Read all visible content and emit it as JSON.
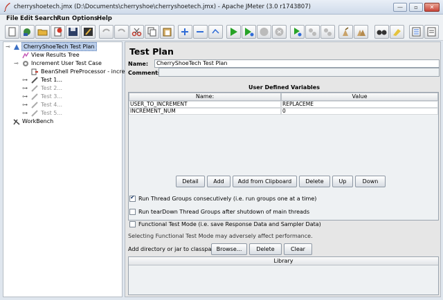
{
  "window": {
    "title": "cherryshoetech.jmx (D:\\Documents\\cherryshoe\\cherryshoetech.jmx) - Apache JMeter (3.0 r1743807)",
    "controls": [
      "—",
      "▫",
      "✕"
    ]
  },
  "menu": [
    "File",
    "Edit",
    "Search",
    "Run",
    "Options",
    "Help"
  ],
  "toolbar": {
    "icons": [
      "new-icon",
      "templates-icon",
      "open-icon",
      "close-icon",
      "save-icon",
      "save-as-icon",
      "cut-icon",
      "copy-icon",
      "paste-icon",
      "expand-icon",
      "collapse-icon",
      "toggle-icon",
      "start-icon",
      "start-no-pause-icon",
      "stop-icon",
      "shutdown-icon",
      "remote-start-icon",
      "remote-stop-icon",
      "remote-shutdown-icon",
      "clear-icon",
      "clear-all-icon",
      "search-icon",
      "reset-search-icon",
      "function-helper-icon",
      "help-icon"
    ]
  },
  "tree": {
    "nodes": [
      {
        "label": "CherryShoeTech Test Plan",
        "icon": "test-plan-icon",
        "selected": true,
        "disabled": false
      },
      {
        "label": "View Results Tree",
        "icon": "listener-icon",
        "selected": false,
        "disabled": false
      },
      {
        "label": "Increment User Test Case",
        "icon": "thread-group-icon",
        "selected": false,
        "disabled": false
      },
      {
        "label": "BeanShell PreProcessor - incre",
        "icon": "preprocessor-icon",
        "selected": false,
        "disabled": false
      },
      {
        "label": "Test 1...",
        "icon": "sampler-icon",
        "selected": false,
        "disabled": false
      },
      {
        "label": "Test 2...",
        "icon": "sampler-icon",
        "selected": false,
        "disabled": true
      },
      {
        "label": "Test 3...",
        "icon": "sampler-icon",
        "selected": false,
        "disabled": true
      },
      {
        "label": "Test 4...",
        "icon": "sampler-icon",
        "selected": false,
        "disabled": true
      },
      {
        "label": "Test 5...",
        "icon": "sampler-icon",
        "selected": false,
        "disabled": true
      },
      {
        "label": "WorkBench",
        "icon": "workbench-icon",
        "selected": false,
        "disabled": false
      }
    ]
  },
  "main": {
    "title": "Test Plan",
    "name_label": "Name:",
    "name_value": "CherryShoeTech Test Plan",
    "comments_label": "Comments:",
    "udv_title": "User Defined Variables",
    "columns": [
      "Name:",
      "Value"
    ],
    "rows": [
      [
        "USER_TO_INCREMENT",
        "REPLACEME"
      ],
      [
        "INCREMENT_NUM",
        "0"
      ]
    ],
    "buttons": [
      "Detail",
      "Add",
      "Add from Clipboard",
      "Delete",
      "Up",
      "Down"
    ],
    "options": [
      {
        "label": "Run Thread Groups consecutively (i.e. run groups one at a time)",
        "checked": true
      },
      {
        "label": "Run tearDown Thread Groups after shutdown of main threads",
        "checked": false
      },
      {
        "label": "Functional Test Mode (i.e. save Response Data and Sampler Data)",
        "checked": false
      }
    ],
    "functional_note": "Selecting Functional Test Mode may adversely affect performance.",
    "classpath_label": "Add directory or jar to classpath",
    "classpath_buttons": [
      "Browse...",
      "Delete",
      "Clear"
    ],
    "library_header": "Library"
  }
}
